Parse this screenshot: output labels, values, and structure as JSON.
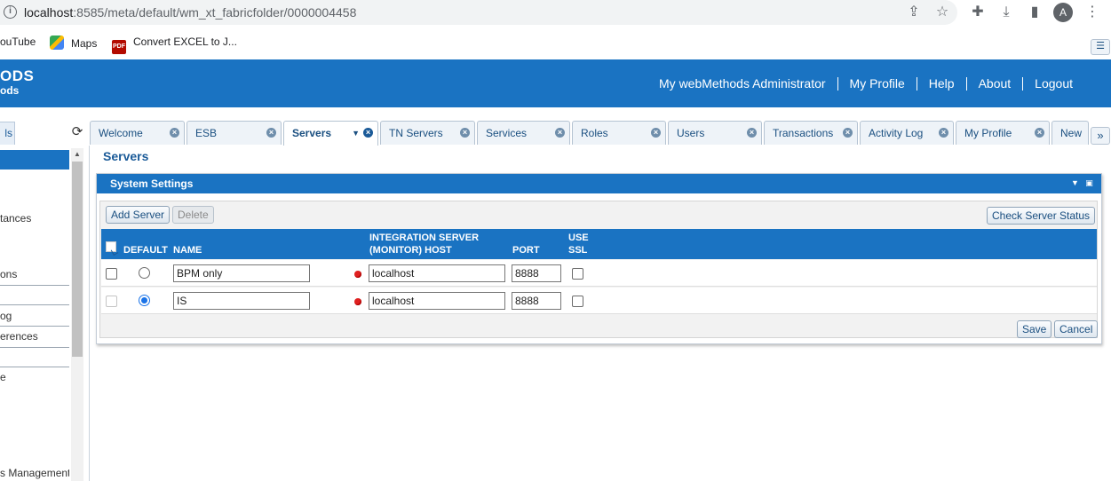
{
  "browser": {
    "url_host": "localhost",
    "url_path": ":8585/meta/default/wm_xt_fabricfolder/0000004458",
    "avatar_letter": "A",
    "bookmarks": [
      {
        "label": "ouTube",
        "icon": "youtube-icon"
      },
      {
        "label": "Maps",
        "icon": "maps-icon"
      },
      {
        "label": "Convert EXCEL to J...",
        "icon": "pdf-icon"
      }
    ]
  },
  "header": {
    "logo_line1": "ODS",
    "logo_line2": "ods",
    "nav": [
      "My webMethods Administrator",
      "My Profile",
      "Help",
      "About",
      "Logout"
    ]
  },
  "tabs": {
    "left_partial": "ls",
    "items": [
      {
        "label": "Welcome",
        "active": false
      },
      {
        "label": "ESB",
        "active": false
      },
      {
        "label": "Servers",
        "active": true
      },
      {
        "label": "TN Servers",
        "active": false
      },
      {
        "label": "Services",
        "active": false
      },
      {
        "label": "Roles",
        "active": false
      },
      {
        "label": "Users",
        "active": false
      },
      {
        "label": "Transactions",
        "active": false
      },
      {
        "label": "Activity Log",
        "active": false
      },
      {
        "label": "My Profile",
        "active": false
      },
      {
        "label": "New",
        "active": false
      }
    ],
    "more": "»"
  },
  "leftnav": {
    "items": [
      "tances",
      "ons",
      "og",
      "erences",
      "e",
      "s Management"
    ]
  },
  "page": {
    "title": "Servers",
    "panel_title": "System Settings",
    "buttons": {
      "add": "Add Server",
      "delete": "Delete",
      "check": "Check Server Status",
      "save": "Save",
      "cancel": "Cancel"
    },
    "columns": {
      "default": "DEFAULT",
      "name": "NAME",
      "host_line1": "INTEGRATION SERVER",
      "host_line2": "(MONITOR) HOST",
      "port": "PORT",
      "ssl_line1": "USE",
      "ssl_line2": "SSL"
    },
    "rows": [
      {
        "name": "BPM only",
        "host": "localhost",
        "port": "8888",
        "default": false,
        "ssl": false,
        "status_color": "#e02020"
      },
      {
        "name": "IS",
        "host": "localhost",
        "port": "8888",
        "default": true,
        "ssl": false,
        "status_color": "#e02020"
      }
    ]
  },
  "colors": {
    "accent": "#1a73c2",
    "status_down": "#e02020"
  }
}
